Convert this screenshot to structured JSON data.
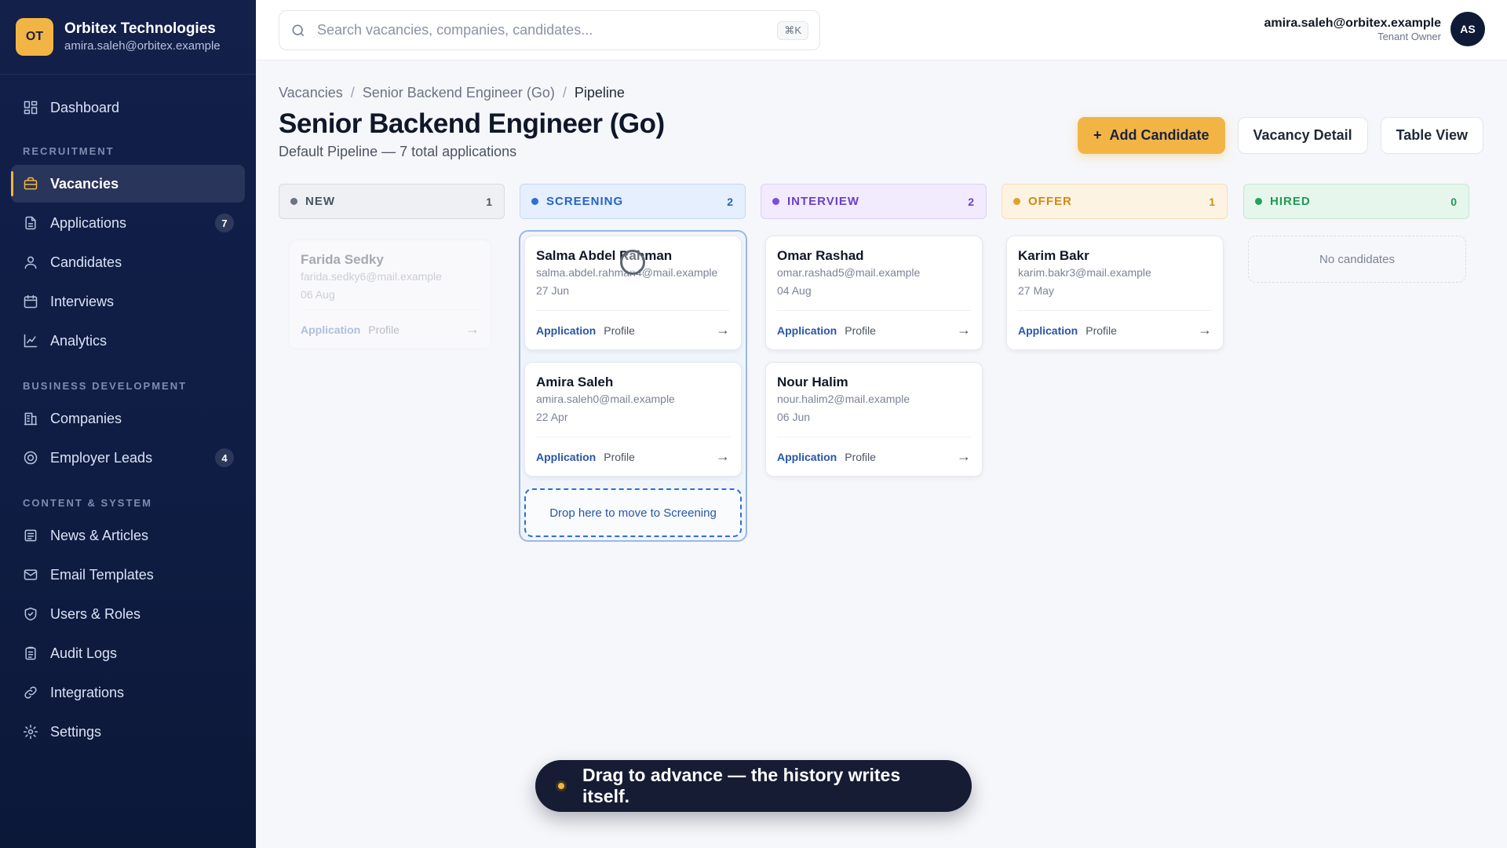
{
  "org": {
    "initials": "OT",
    "name": "Orbitex Technologies",
    "email": "amira.saleh@orbitex.example"
  },
  "nav": {
    "dashboard": "Dashboard",
    "section_recruitment": "RECRUITMENT",
    "vacancies": "Vacancies",
    "applications": "Applications",
    "applications_count": "7",
    "candidates": "Candidates",
    "interviews": "Interviews",
    "analytics": "Analytics",
    "section_bizdev": "BUSINESS DEVELOPMENT",
    "companies": "Companies",
    "employer_leads": "Employer Leads",
    "employer_leads_count": "4",
    "section_content": "CONTENT & SYSTEM",
    "news": "News & Articles",
    "email_templates": "Email Templates",
    "users_roles": "Users & Roles",
    "audit_logs": "Audit Logs",
    "integrations": "Integrations",
    "settings": "Settings"
  },
  "topbar": {
    "search_placeholder": "Search vacancies, companies, candidates...",
    "search_shortcut": "⌘K",
    "user_email": "amira.saleh@orbitex.example",
    "user_role": "Tenant Owner",
    "user_initials": "AS"
  },
  "breadcrumb": {
    "b1": "Vacancies",
    "b2": "Senior Backend Engineer (Go)",
    "b3": "Pipeline"
  },
  "page": {
    "title": "Senior Backend Engineer (Go)",
    "subtitle": "Default Pipeline — 7 total applications"
  },
  "actions": {
    "add": "Add Candidate",
    "add_icon": "+",
    "detail": "Vacancy Detail",
    "table": "Table View"
  },
  "columns": {
    "new": {
      "label": "NEW",
      "count": "1"
    },
    "screening": {
      "label": "SCREENING",
      "count": "2"
    },
    "interview": {
      "label": "INTERVIEW",
      "count": "2"
    },
    "offer": {
      "label": "OFFER",
      "count": "1"
    },
    "hired": {
      "label": "HIRED",
      "count": "0"
    }
  },
  "cards": {
    "farida": {
      "name": "Farida Sedky",
      "email": "farida.sedky6@mail.example",
      "date": "06 Aug"
    },
    "salma": {
      "name": "Salma Abdel Rahman",
      "email": "salma.abdel.rahman4@mail.example",
      "date": "27 Jun"
    },
    "amira": {
      "name": "Amira Saleh",
      "email": "amira.saleh0@mail.example",
      "date": "22 Apr"
    },
    "omar": {
      "name": "Omar Rashad",
      "email": "omar.rashad5@mail.example",
      "date": "04 Aug"
    },
    "nour": {
      "name": "Nour Halim",
      "email": "nour.halim2@mail.example",
      "date": "06 Jun"
    },
    "karim": {
      "name": "Karim Bakr",
      "email": "karim.bakr3@mail.example",
      "date": "27 May"
    }
  },
  "card_links": {
    "application": "Application",
    "profile": "Profile",
    "arrow": "→"
  },
  "drop_hint": "Drop here to move to Screening",
  "hired_empty": "No candidates",
  "toast": "Drag to advance — the history writes itself."
}
